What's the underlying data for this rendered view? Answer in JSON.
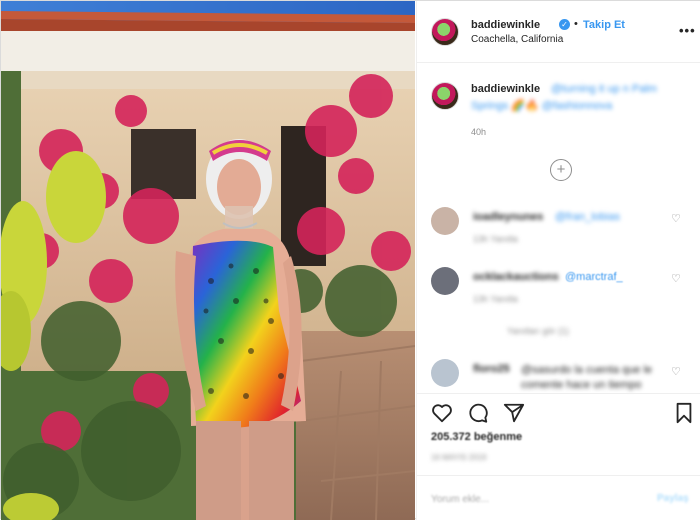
{
  "post": {
    "photo_alt": "",
    "header": {
      "username": "baddiewinkle",
      "verified_mark": "✓",
      "separator": "•",
      "follow_label": "Takip Et",
      "location": "Coachella, California",
      "more_label": "•••"
    },
    "caption": {
      "username": "baddiewinkle",
      "text_part1": "@turning it up n Palm",
      "text_part2": "Springs 🌈🔥 @fashionnova",
      "time": "40h",
      "load_more_symbol": "+"
    },
    "comments": [
      {
        "username": "ioadleynunes",
        "text": "@fran_lobias",
        "meta": "13h   Yanıtla",
        "avatar_color": "#c9b3a6"
      },
      {
        "username": "ocklackauctions",
        "text": "@marctraf_",
        "meta": "13h   Yanıtla",
        "avatar_color": "#6c6f7a"
      },
      {
        "username": "floro25",
        "text": "@sasurdo la cuenta que le comente hace un tiempo",
        "meta": "",
        "avatar_color": "#b9c4d0"
      }
    ],
    "view_replies": "Yanıtları gör (1)",
    "likes": "205.372 beğenme",
    "date": "16 MAYIS 2019",
    "add_comment_placeholder": "Yorum ekle...",
    "post_label": "Paylaş",
    "colors": {
      "accent": "#3897f0",
      "text": "#262626",
      "muted": "#8e8e8e",
      "border": "#efefef"
    },
    "icons": [
      "heart-icon",
      "comment-icon",
      "share-icon",
      "bookmark-icon",
      "plus-circle-icon",
      "more-icon",
      "verified-icon"
    ]
  }
}
